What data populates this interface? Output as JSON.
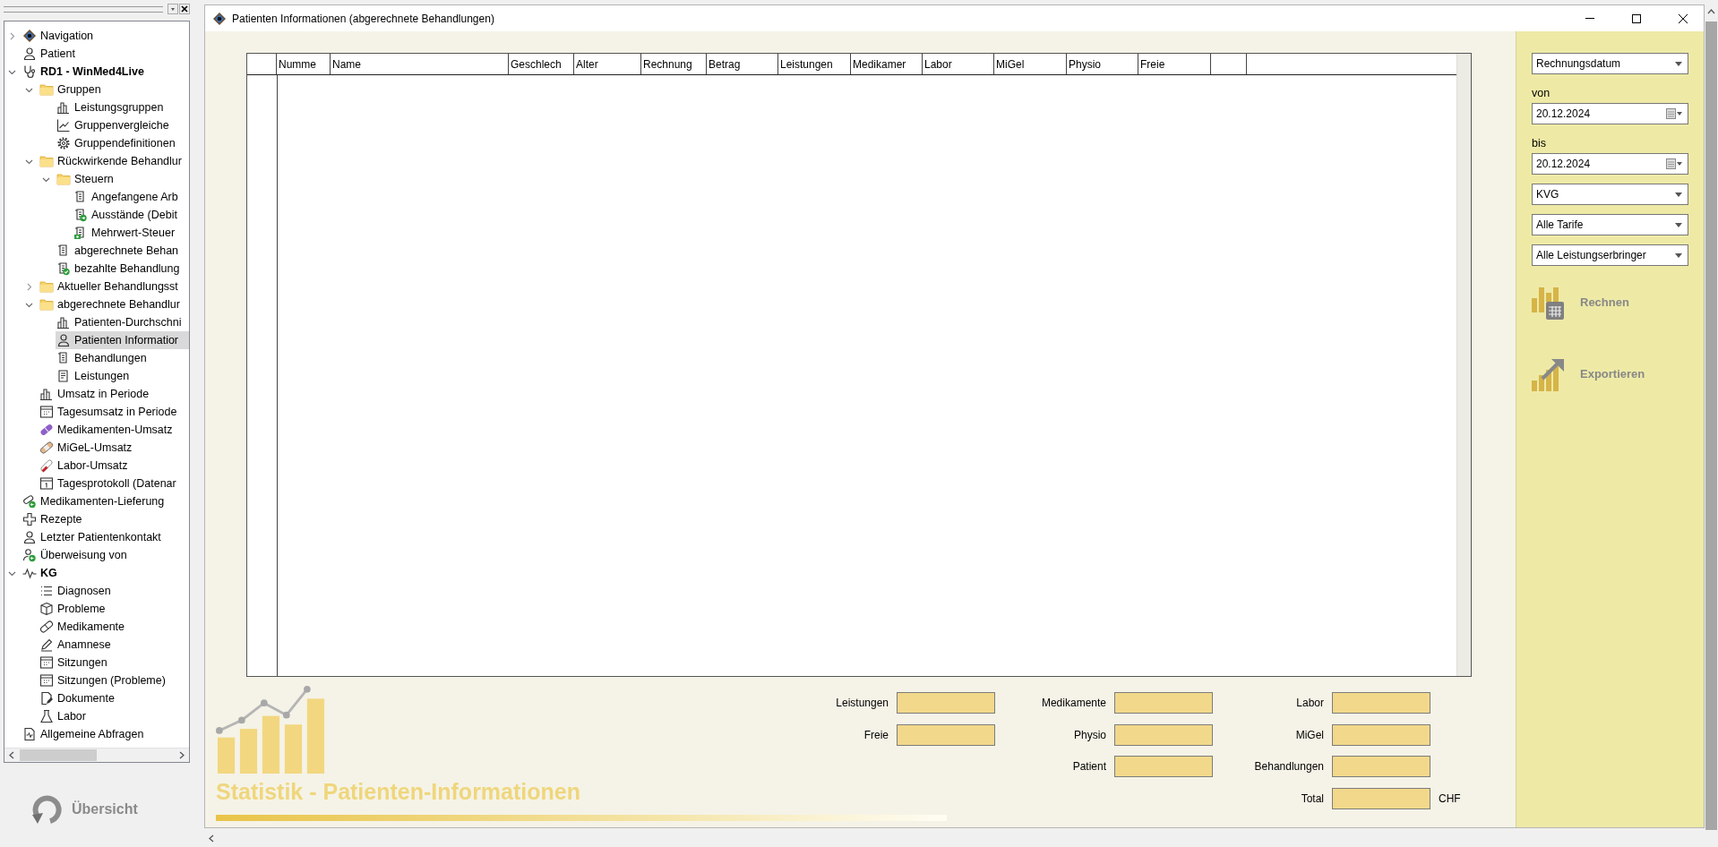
{
  "tree": {
    "items": [
      {
        "label": "Navigation",
        "kind": "nav",
        "expanded": false,
        "selected": false
      },
      {
        "label": "Patient",
        "kind": "person",
        "selected": false
      },
      {
        "label": "RD1 - WinMed4Live",
        "kind": "stethoscope",
        "bold": true,
        "expanded": true,
        "selected": false,
        "children": [
          {
            "label": "Gruppen",
            "kind": "folder",
            "expanded": true,
            "selected": false,
            "children": [
              {
                "label": "Leistungsgruppen",
                "kind": "bars",
                "selected": false
              },
              {
                "label": "Gruppenvergleiche",
                "kind": "linechart",
                "selected": false
              },
              {
                "label": "Gruppendefinitionen",
                "kind": "gear",
                "selected": false
              }
            ]
          },
          {
            "label": "Rückwirkende Behandlur",
            "kind": "folder",
            "expanded": true,
            "selected": false,
            "children": [
              {
                "label": "Steuern",
                "kind": "folder",
                "expanded": true,
                "selected": false,
                "children": [
                  {
                    "label": "Angefangene Arb",
                    "kind": "doc",
                    "selected": false
                  },
                  {
                    "label": "Ausstände (Debit",
                    "kind": "doc-badge",
                    "selected": false
                  },
                  {
                    "label": "Mehrwert-Steuer",
                    "kind": "doc-money",
                    "selected": false
                  }
                ]
              },
              {
                "label": "abgerechnete Behan",
                "kind": "doc",
                "selected": false
              },
              {
                "label": "bezahlte Behandlung",
                "kind": "doc-check",
                "selected": false
              }
            ]
          },
          {
            "label": "Aktueller Behandlungsst",
            "kind": "folder",
            "expanded": false,
            "selected": false
          },
          {
            "label": "abgerechnete Behandlur",
            "kind": "folder",
            "expanded": true,
            "selected": false,
            "children": [
              {
                "label": "Patienten-Durchschni",
                "kind": "bars",
                "selected": false
              },
              {
                "label": "Patienten Informatior",
                "kind": "person",
                "selected": true
              },
              {
                "label": "Behandlungen",
                "kind": "doc",
                "selected": false
              },
              {
                "label": "Leistungen",
                "kind": "doc-list",
                "selected": false
              }
            ]
          },
          {
            "label": "Umsatz in Periode",
            "kind": "bars",
            "selected": false
          },
          {
            "label": "Tagesumsatz in Periode",
            "kind": "calendar",
            "selected": false
          },
          {
            "label": "Medikamenten-Umsatz",
            "kind": "pill",
            "selected": false
          },
          {
            "label": "MiGeL-Umsatz",
            "kind": "bandage",
            "selected": false
          },
          {
            "label": "Labor-Umsatz",
            "kind": "tube",
            "selected": false
          },
          {
            "label": "Tagesprotokoll (Datenar",
            "kind": "calendar-day",
            "selected": false
          }
        ]
      },
      {
        "label": "Medikamenten-Lieferung",
        "kind": "pill-badge",
        "selected": false
      },
      {
        "label": "Rezepte",
        "kind": "cross",
        "selected": false
      },
      {
        "label": "Letzter Patientenkontakt",
        "kind": "person",
        "selected": false
      },
      {
        "label": "Überweisung von",
        "kind": "person-badge",
        "selected": false
      },
      {
        "label": "KG",
        "kind": "pulse",
        "bold": true,
        "expanded": true,
        "selected": false,
        "children": [
          {
            "label": "Diagnosen",
            "kind": "list",
            "selected": false
          },
          {
            "label": "Probleme",
            "kind": "box",
            "selected": false
          },
          {
            "label": "Medikamente",
            "kind": "capsule",
            "selected": false
          },
          {
            "label": "Anamnese",
            "kind": "pencil",
            "selected": false
          },
          {
            "label": "Sitzungen",
            "kind": "calendar",
            "selected": false
          },
          {
            "label": "Sitzungen (Probleme)",
            "kind": "calendar",
            "selected": false
          },
          {
            "label": "Dokumente",
            "kind": "doc-edit",
            "selected": false
          },
          {
            "label": "Labor",
            "kind": "flask",
            "selected": false
          }
        ]
      },
      {
        "label": "Allgemeine Abfragen",
        "kind": "doc-chart",
        "selected": false
      }
    ]
  },
  "overview_button": {
    "label": "Übersicht"
  },
  "window": {
    "title": "Patienten Informationen (abgerechnete Behandlungen)"
  },
  "table": {
    "columns": [
      "Numme",
      "Name",
      "Geschlech",
      "Alter",
      "Rechnung",
      "Betrag",
      "Leistungen",
      "Medikamer",
      "Labor",
      "MiGel",
      "Physio",
      "Freie"
    ]
  },
  "logo": {
    "title": "Statistik - Patienten-Informationen"
  },
  "totals": {
    "column_1": [
      {
        "label": "Leistungen"
      },
      {
        "label": "Freie"
      }
    ],
    "column_2": [
      {
        "label": "Medikamente"
      },
      {
        "label": "Physio"
      },
      {
        "label": "Patient"
      }
    ],
    "column_3": [
      {
        "label": "Labor"
      },
      {
        "label": "MiGel"
      },
      {
        "label": "Behandlungen"
      },
      {
        "label": "Total",
        "unit": "CHF"
      }
    ]
  },
  "side_panel": {
    "date_type": {
      "value": "Rechnungsdatum"
    },
    "from": {
      "label": "von",
      "value": "20.12.2024"
    },
    "to": {
      "label": "bis",
      "value": "20.12.2024"
    },
    "dropdowns": [
      {
        "value": "KVG"
      },
      {
        "value": "Alle Tarife"
      },
      {
        "value": "Alle Leistungserbringer"
      }
    ],
    "actions": [
      {
        "label": "Rechnen",
        "kind": "calculate"
      },
      {
        "label": "Exportieren",
        "kind": "export"
      }
    ]
  }
}
